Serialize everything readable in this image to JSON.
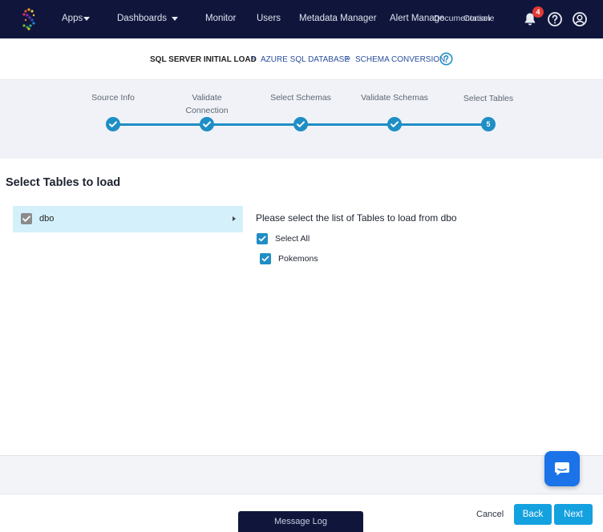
{
  "nav": {
    "items": [
      {
        "label": "Apps"
      },
      {
        "label": "Dashboards"
      },
      {
        "label": "Monitor"
      },
      {
        "label": "Users"
      },
      {
        "label": "Metadata Manager"
      },
      {
        "label": "Alert Manage"
      },
      {
        "label": "Documentation"
      },
      {
        "label": "Console"
      }
    ],
    "notification_count": "4",
    "icons": [
      "striim-logo-icon",
      "bell-icon",
      "help-icon",
      "user-icon"
    ]
  },
  "breadcrumb": {
    "items": [
      {
        "label": "SQL SERVER INITIAL LOAD"
      },
      {
        "label": "AZURE SQL DATABASE"
      },
      {
        "label": "SCHEMA CONVERSION"
      }
    ],
    "separator": "»"
  },
  "stepper": {
    "steps": [
      {
        "label": "Source Info",
        "status": "done"
      },
      {
        "label": "Validate\nConnection",
        "status": "done"
      },
      {
        "label": "Select Schemas",
        "status": "done"
      },
      {
        "label": "Validate Schemas",
        "status": "done"
      },
      {
        "label": "Select Tables",
        "status": "current",
        "number": "5"
      }
    ]
  },
  "main": {
    "title": "Select Tables to load",
    "schemas": [
      {
        "label": "dbo",
        "checked": true
      }
    ],
    "tables_heading": "Please select the list of Tables to load from dbo",
    "select_all_label": "Select All",
    "tables": [
      {
        "label": "Pokemons",
        "checked": true
      }
    ]
  },
  "footer": {
    "message_log": "Message Log",
    "cancel": "Cancel",
    "back": "Back",
    "next": "Next"
  },
  "colors": {
    "nav_bg": "#10163b",
    "accent": "#1f8ec5",
    "button": "#14a1e0",
    "schema_selected_bg": "#d3f0fb",
    "badge": "#e53935",
    "chat": "#1a73e8"
  }
}
